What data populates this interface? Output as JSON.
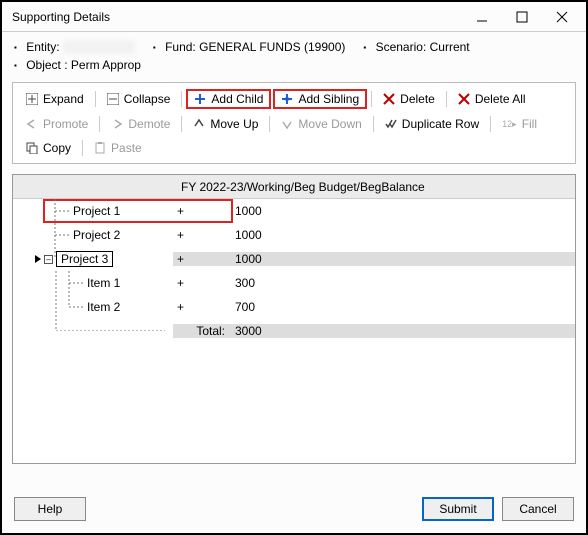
{
  "window": {
    "title": "Supporting Details"
  },
  "context": {
    "entity_label": "Entity:",
    "entity_value": "REDACTED",
    "fund_label": "Fund:",
    "fund_value": "GENERAL FUNDS (19900)",
    "scenario_label": "Scenario:",
    "scenario_value": "Current",
    "object_label": "Object :",
    "object_value": "Perm Approp"
  },
  "toolbar": {
    "expand": "Expand",
    "collapse": "Collapse",
    "add_child": "Add Child",
    "add_sibling": "Add Sibling",
    "delete": "Delete",
    "delete_all": "Delete All",
    "promote": "Promote",
    "demote": "Demote",
    "move_up": "Move Up",
    "move_down": "Move Down",
    "duplicate_row": "Duplicate Row",
    "fill": "Fill",
    "copy": "Copy",
    "paste": "Paste"
  },
  "grid": {
    "header": "FY 2022-23/Working/Beg Budget/BegBalance",
    "rows": [
      {
        "label": "Project 1",
        "op": "+",
        "value": "1000",
        "level": 0,
        "shaded": false,
        "highlight": true
      },
      {
        "label": "Project 2",
        "op": "+",
        "value": "1000",
        "level": 0,
        "shaded": false
      },
      {
        "label": "Project 3",
        "op": "+",
        "value": "1000",
        "level": 0,
        "shaded": true,
        "selected": true,
        "expandable": true,
        "arrow": true
      },
      {
        "label": "Item 1",
        "op": "+",
        "value": "300",
        "level": 1,
        "shaded": false
      },
      {
        "label": "Item 2",
        "op": "+",
        "value": "700",
        "level": 1,
        "shaded": false
      }
    ],
    "total_label": "Total:",
    "total_value": "3000"
  },
  "footer": {
    "help": "Help",
    "submit": "Submit",
    "cancel": "Cancel"
  }
}
